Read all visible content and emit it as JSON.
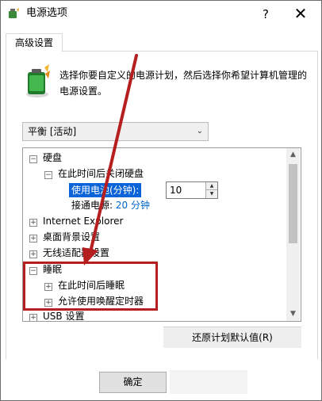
{
  "window": {
    "title": "电源选项",
    "help_label": "?",
    "close_label": "✕"
  },
  "tabs": [
    {
      "label": "高级设置"
    }
  ],
  "description": "选择你要自定义的电源计划，然后选择你希望计算机管理的电源设置。",
  "plan_select": {
    "value": "平衡 [活动]"
  },
  "tree": {
    "items": [
      {
        "label": "硬盘",
        "expander": "−"
      },
      {
        "label": "在此时间后关闭硬盘",
        "expander": "−"
      },
      {
        "label": "使用电池(分钟):"
      },
      {
        "label": "接通电源:",
        "value": "20 分钟"
      },
      {
        "label": "Internet Explorer",
        "expander": "+"
      },
      {
        "label": "桌面背景设置",
        "expander": "+"
      },
      {
        "label": "无线适配器设置",
        "expander": "+"
      },
      {
        "label": "睡眠",
        "expander": "−"
      },
      {
        "label": "在此时间后睡眠",
        "expander": "+"
      },
      {
        "label": "允许使用唤醒定时器",
        "expander": "+"
      },
      {
        "label": "USB 设置",
        "expander": "+"
      }
    ],
    "battery_minutes": "10"
  },
  "buttons": {
    "restore": "还原计划默认值(R)",
    "ok": "确定"
  },
  "colors": {
    "selection": "#0a64d8",
    "annotation": "#b51f1f",
    "link": "#0066cc"
  }
}
